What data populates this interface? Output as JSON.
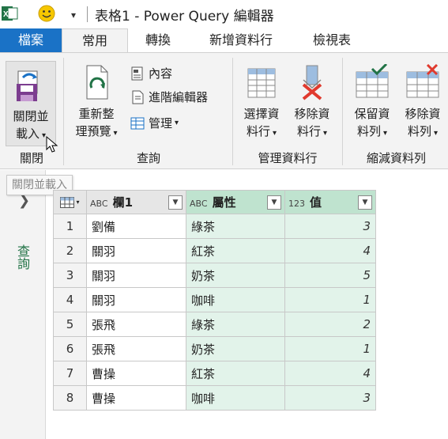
{
  "app": {
    "title": "表格1 - Power Query 編輯器"
  },
  "tabs": [
    "檔案",
    "常用",
    "轉換",
    "新增資料行",
    "檢視表"
  ],
  "ribbon": {
    "close_load": {
      "line1": "關閉並",
      "line2": "載入"
    },
    "refresh_preview": {
      "line1": "重新整",
      "line2": "理預覽"
    },
    "properties": "內容",
    "advanced_editor": "進階編輯器",
    "manage": "管理",
    "choose_columns": {
      "line1": "選擇資",
      "line2": "料行"
    },
    "remove_columns": {
      "line1": "移除資",
      "line2": "料行"
    },
    "keep_rows": {
      "line1": "保留資",
      "line2": "料列"
    },
    "remove_rows": {
      "line1": "移除資",
      "line2": "料列"
    },
    "groups": {
      "close": "關閉",
      "query": "查詢",
      "manage_columns": "管理資料行",
      "reduce_rows": "縮減資料列"
    }
  },
  "tooltip": "關閉並載入",
  "left_pane": {
    "label": "查詢"
  },
  "grid": {
    "columns": [
      {
        "type_icon": "ABC",
        "name": "欄1"
      },
      {
        "type_icon": "ABC",
        "name": "屬性"
      },
      {
        "type_icon": "123",
        "name": "值"
      }
    ],
    "rows": [
      {
        "num": "1",
        "c1": "劉備",
        "c2": "綠茶",
        "c3": "3"
      },
      {
        "num": "2",
        "c1": "關羽",
        "c2": "紅茶",
        "c3": "4"
      },
      {
        "num": "3",
        "c1": "關羽",
        "c2": "奶茶",
        "c3": "5"
      },
      {
        "num": "4",
        "c1": "關羽",
        "c2": "咖啡",
        "c3": "1"
      },
      {
        "num": "5",
        "c1": "張飛",
        "c2": "綠茶",
        "c3": "2"
      },
      {
        "num": "6",
        "c1": "張飛",
        "c2": "奶茶",
        "c3": "1"
      },
      {
        "num": "7",
        "c1": "曹操",
        "c2": "紅茶",
        "c3": "4"
      },
      {
        "num": "8",
        "c1": "曹操",
        "c2": "咖啡",
        "c3": "3"
      }
    ]
  },
  "colors": {
    "file_tab": "#1a72c6",
    "excel_green": "#217346",
    "selected_col": "#bfe3cf",
    "selected_cell": "#e2f3ea"
  }
}
